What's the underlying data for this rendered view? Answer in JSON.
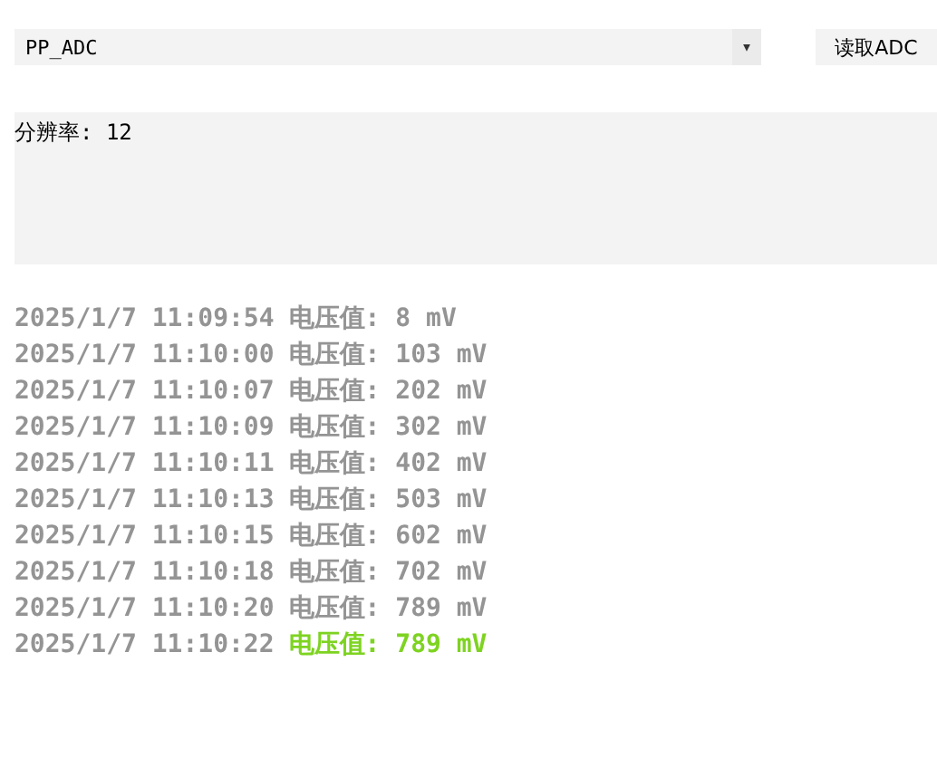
{
  "port_dropdown": {
    "value": "PP_ADC",
    "arrow": "▾"
  },
  "read_button": {
    "label": "读取ADC"
  },
  "info_box": {
    "text": "分辨率: 12"
  },
  "log": [
    {
      "time": "2025/1/7 11:09:54",
      "reading": "电压值: 8 mV",
      "latest": false
    },
    {
      "time": "2025/1/7 11:10:00",
      "reading": "电压值: 103 mV",
      "latest": false
    },
    {
      "time": "2025/1/7 11:10:07",
      "reading": "电压值: 202 mV",
      "latest": false
    },
    {
      "time": "2025/1/7 11:10:09",
      "reading": "电压值: 302 mV",
      "latest": false
    },
    {
      "time": "2025/1/7 11:10:11",
      "reading": "电压值: 402 mV",
      "latest": false
    },
    {
      "time": "2025/1/7 11:10:13",
      "reading": "电压值: 503 mV",
      "latest": false
    },
    {
      "time": "2025/1/7 11:10:15",
      "reading": "电压值: 602 mV",
      "latest": false
    },
    {
      "time": "2025/1/7 11:10:18",
      "reading": "电压值: 702 mV",
      "latest": false
    },
    {
      "time": "2025/1/7 11:10:20",
      "reading": "电压值: 789 mV",
      "latest": false
    },
    {
      "time": "2025/1/7 11:10:22",
      "reading": "电压值: 789 mV",
      "latest": true
    }
  ]
}
